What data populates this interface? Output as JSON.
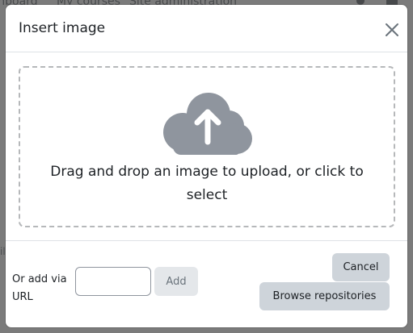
{
  "background": {
    "nav_items": [
      "shboard",
      "My courses",
      "Site administration"
    ],
    "side_text": "il"
  },
  "modal": {
    "title": "Insert image",
    "close_icon": "close-icon",
    "dropzone": {
      "icon": "cloud-upload-icon",
      "text": "Drag and drop an image to upload, or click to select"
    },
    "footer": {
      "url_label": "Or add via URL",
      "url_input_value": "",
      "add_label": "Add",
      "cancel_label": "Cancel",
      "browse_label": "Browse repositories"
    }
  },
  "colors": {
    "icon_gray": "#8f959e",
    "button_gray": "#ced4da",
    "text": "#1d2125"
  }
}
